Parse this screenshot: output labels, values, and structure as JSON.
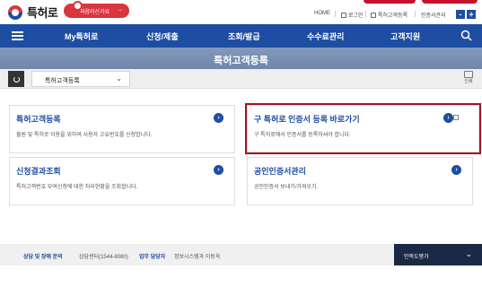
{
  "header": {
    "logo_text": "특허로",
    "promo_label": "처음이신가요",
    "promo_arrow": "→",
    "util_links": [
      "HOME",
      "로그인",
      "특허고객등록",
      "인증서관리"
    ],
    "font_minus": "-",
    "font_plus": "+"
  },
  "nav": {
    "items": [
      "My특허로",
      "신청/제출",
      "조회/발급",
      "수수료관리",
      "고객지원"
    ]
  },
  "banner": {
    "title": "특허고객등록"
  },
  "crumb": {
    "selected": "특허고객등록",
    "print_label": "인쇄"
  },
  "cards": [
    {
      "title": "특허고객등록",
      "desc": "출원 및 특허로 이용을 위하여 사용자 고유번호를 신청합니다."
    },
    {
      "title": "구 특허로 인증서 등록 바로가기",
      "desc": "구 특허로에서 인증서를 등록하셔야 합니다."
    },
    {
      "title": "신청결과조회",
      "desc": "특허고객번호 부여신청에 대한 처리현황을 조회합니다."
    },
    {
      "title": "공인인증서관리",
      "desc": "공인인증서 보내기/가져오기."
    }
  ],
  "footer": {
    "label1": "상담 및 장애 문의",
    "text1": "상담센터(1544-8080)",
    "label2": "업무 담당자",
    "text2": "정보시스템과 이동욱",
    "survey_label": "만족도평가"
  },
  "colors": {
    "primary": "#1e4ea1",
    "accent_red": "#d9363e",
    "highlight": "#a8121b"
  }
}
